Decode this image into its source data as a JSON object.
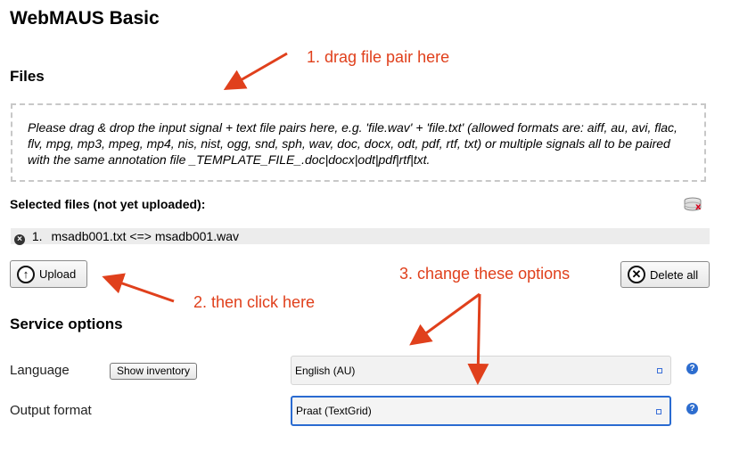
{
  "title": "WebMAUS Basic",
  "files_heading": "Files",
  "dropzone_text": "Please drag & drop the input signal + text file pairs here, e.g. 'file.wav' + 'file.txt' (allowed formats are: aiff, au, avi, flac, flv, mpg, mp3, mpeg, mp4, nis, nist, ogg, snd, sph, wav, doc, docx, odt, pdf, rtf, txt) or multiple signals all to be paired with the same annotation file _TEMPLATE_FILE_.doc|docx|odt|pdf|rtf|txt.",
  "selected_label": "Selected files (not yet uploaded):",
  "files": [
    {
      "number": "1.",
      "text": "msadb001.txt <=> msadb001.wav"
    }
  ],
  "upload_label": "Upload",
  "delete_all_label": "Delete all",
  "service_heading": "Service options",
  "language": {
    "label": "Language",
    "inventory_button": "Show inventory",
    "value": "English (AU)"
  },
  "output_format": {
    "label": "Output format",
    "value": "Praat (TextGrid)"
  },
  "annotations": {
    "step1": "1. drag file pair here",
    "step2": "2. then click here",
    "step3": "3. change these options"
  },
  "colors": {
    "annotation": "#e0401c",
    "accent": "#2a6bd1"
  },
  "icons": {
    "upload": "arrow-up-circle-icon",
    "delete_all": "x-circle-icon",
    "remove_file": "remove-x-icon",
    "clear_list": "database-x-icon",
    "help": "question-icon"
  }
}
